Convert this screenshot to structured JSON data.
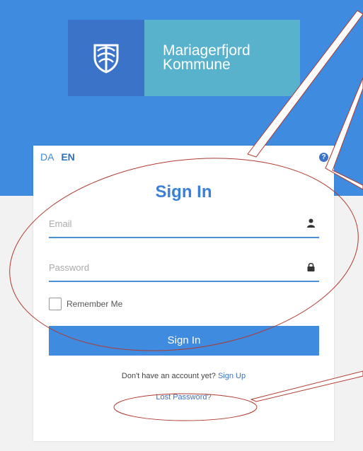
{
  "org": {
    "name_line1": "Mariagerfjord",
    "name_line2": "Kommune"
  },
  "lang": {
    "da": "DA",
    "en": "EN"
  },
  "form": {
    "title": "Sign In",
    "email_placeholder": "Email",
    "password_placeholder": "Password",
    "remember_label": "Remember Me",
    "submit_label": "Sign In",
    "no_account_text": "Don't have an account yet?",
    "signup_link": "Sign Up",
    "lost_password_link": "Lost Password?"
  },
  "colors": {
    "brand_blue": "#3f8be0",
    "crest_blue": "#3a73c7",
    "logo_teal": "#58b2cc",
    "annotation_red": "#b03a2e"
  },
  "icons": {
    "help": "question-circle-icon",
    "user": "user-icon",
    "lock": "lock-icon"
  }
}
